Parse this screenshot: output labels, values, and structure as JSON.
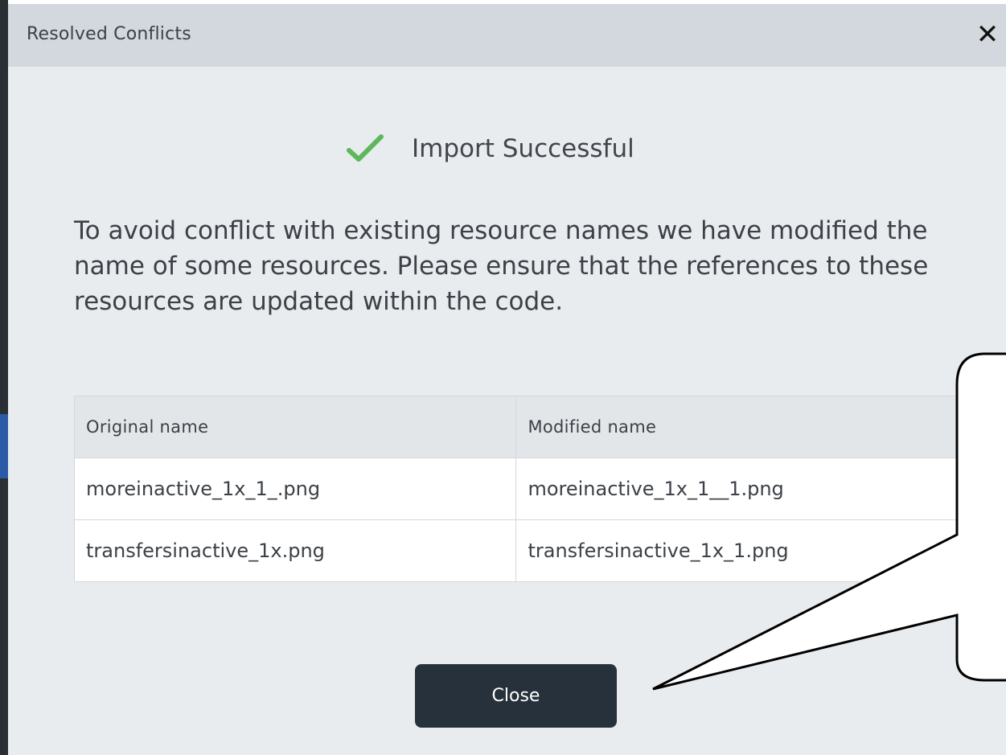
{
  "dialog": {
    "title": "Resolved Conflicts",
    "close_icon": "close-icon",
    "status": {
      "icon": "checkmark-icon",
      "icon_color": "#5cb85c",
      "text": "Import Successful"
    },
    "message": "To avoid conflict with existing resource names we have modified the name of some resources. Please ensure that the references to these resources are updated within the code.",
    "table": {
      "headers": [
        "Original name",
        "Modified name"
      ],
      "rows": [
        [
          "moreinactive_1x_1_.png",
          "moreinactive_1x_1__1.png"
        ],
        [
          "transfersinactive_1x.png",
          "transfersinactive_1x_1.png"
        ]
      ]
    },
    "close_button_label": "Close",
    "close_button_color": "#27313b"
  }
}
